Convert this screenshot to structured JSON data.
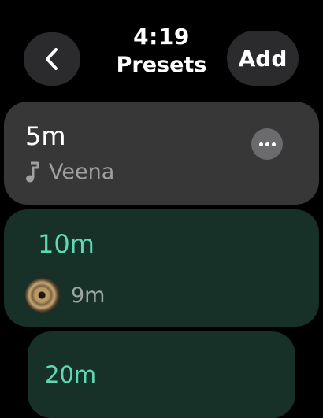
{
  "header": {
    "back_icon": "chevron-left-icon",
    "time": "4:19",
    "title": "Presets",
    "add_label": "Add"
  },
  "presets": [
    {
      "duration": "5m",
      "sound_icon": "music-note-icon",
      "sound": "Veena",
      "more_icon": "ellipsis-icon"
    },
    {
      "duration": "10m",
      "sound_icon": "cymbal-icon",
      "sound": "9m"
    },
    {
      "duration": "20m"
    }
  ],
  "colors": {
    "accent": "#5fd9b3",
    "card_dark": "#373737",
    "card_green": "#173028",
    "button_bg": "#2b2b2d"
  }
}
